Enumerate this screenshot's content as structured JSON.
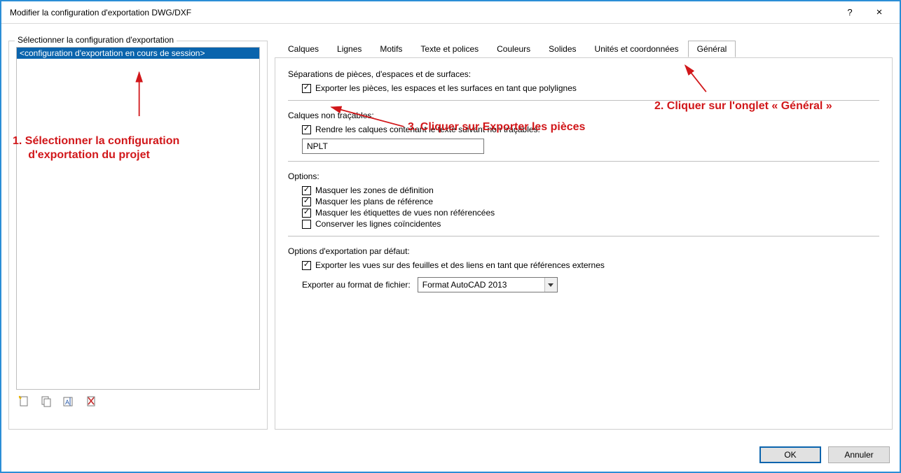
{
  "window": {
    "title": "Modifier la configuration d'exportation DWG/DXF",
    "help": "?",
    "close": "×"
  },
  "left": {
    "group_label": "Sélectionner la configuration d'exportation",
    "item_selected": "<configuration d'exportation en cours de session>",
    "icons": {
      "new": "new-config-icon",
      "copy": "copy-icon",
      "rename": "rename-icon",
      "delete": "delete-icon"
    }
  },
  "tabs": {
    "calques": "Calques",
    "lignes": "Lignes",
    "motifs": "Motifs",
    "texte": "Texte et polices",
    "couleurs": "Couleurs",
    "solides": "Solides",
    "unites": "Unités et coordonnées",
    "general": "Général"
  },
  "general": {
    "sep_label": "Séparations de pièces, d'espaces et de surfaces:",
    "cb_export_pieces": "Exporter les pièces, les espaces et les surfaces en tant que polylignes",
    "nonplot_label": "Calques non traçables:",
    "cb_nonplot": "Rendre les calques contenant le texte suivant non traçables:",
    "nonplot_value": "NPLT",
    "options_label": "Options:",
    "cb_hide_def": "Masquer les zones de définition",
    "cb_hide_refplanes": "Masquer les plans de référence",
    "cb_hide_unref_tags": "Masquer les étiquettes de vues non référencées",
    "cb_keep_coincident": "Conserver les lignes coïncidentes",
    "defexp_label": "Options d'exportation par défaut:",
    "cb_export_views_xref": "Exporter les vues sur des feuilles et des liens en tant que références externes",
    "format_label": "Exporter au format de fichier:",
    "format_value": "Format AutoCAD 2013"
  },
  "buttons": {
    "ok": "OK",
    "cancel": "Annuler"
  },
  "annotations": {
    "a1": "1. Sélectionner la configuration\n     d'exportation du projet",
    "a2": "2. Cliquer sur l'onglet « Général »",
    "a3": "3. Cliquer sur Exporter les pièces"
  }
}
